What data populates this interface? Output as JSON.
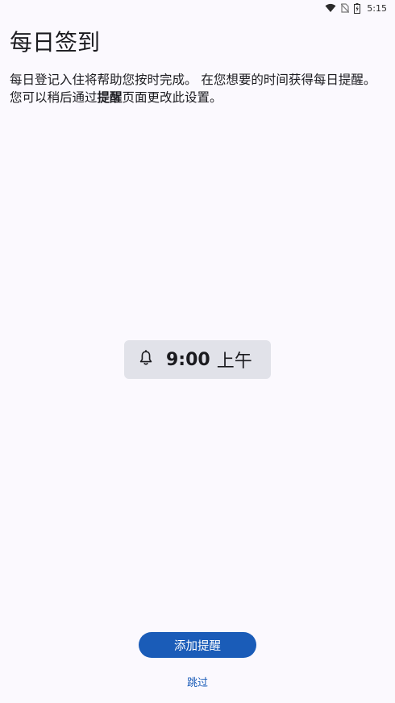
{
  "status_bar": {
    "time": "5:15",
    "icons": [
      "wifi-icon",
      "no-sim-icon",
      "battery-icon"
    ]
  },
  "page": {
    "title": "每日签到",
    "description_part1": "每日登记入住将帮助您按时完成。 在您想要的时间获得每日提醒。 您可以稍后通过",
    "description_bold": "提醒",
    "description_part2": "页面更改此设置。"
  },
  "reminder": {
    "icon": "bell-icon",
    "time": "9:00",
    "ampm": "上午"
  },
  "actions": {
    "add_reminder_label": "添加提醒",
    "skip_label": "跳过"
  },
  "colors": {
    "background": "#fbf9fe",
    "chip_background": "#e1e2e9",
    "accent": "#1a5cb8"
  }
}
